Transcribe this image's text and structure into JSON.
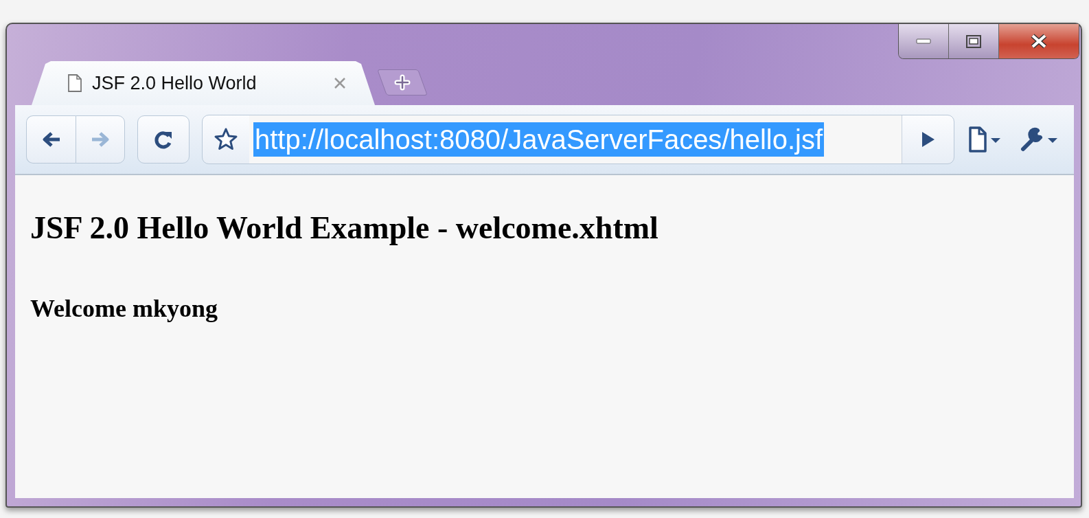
{
  "window": {
    "controls": [
      {
        "kind": "minimize"
      },
      {
        "kind": "maximize"
      },
      {
        "kind": "close"
      }
    ]
  },
  "tabs": [
    {
      "title": "JSF 2.0 Hello World",
      "selected": true
    }
  ],
  "toolbar": {
    "back_disabled": false,
    "forward_disabled": true,
    "url": "http://localhost:8080/JavaServerFaces/hello.jsf",
    "url_selected": true
  },
  "page": {
    "heading": "JSF 2.0 Hello World Example - welcome.xhtml",
    "text": "Welcome mkyong"
  }
}
